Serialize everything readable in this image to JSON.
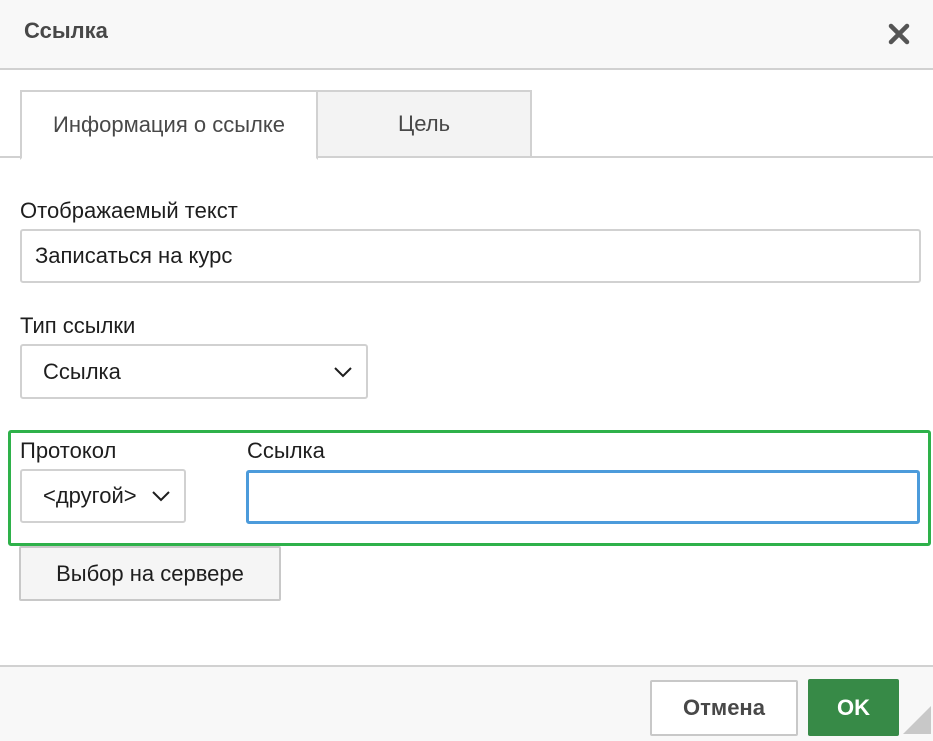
{
  "dialog": {
    "title": "Ссылка",
    "close_icon": "close-icon"
  },
  "tabs": [
    {
      "label": "Информация о ссылке",
      "active": true
    },
    {
      "label": "Цель",
      "active": false
    }
  ],
  "form": {
    "display_text": {
      "label": "Отображаемый текст",
      "value": "Записаться на курс"
    },
    "link_type": {
      "label": "Тип ссылки",
      "selected": "Ссылка"
    },
    "protocol": {
      "label": "Протокол",
      "selected": "<другой>"
    },
    "url": {
      "label": "Ссылка",
      "value": ""
    },
    "browse_server_label": "Выбор на сервере"
  },
  "footer": {
    "cancel_label": "Отмена",
    "ok_label": "OK"
  },
  "colors": {
    "ok_button": "#378a47",
    "highlight_border": "#2eb14a",
    "focus_border": "#4c9bdb"
  }
}
